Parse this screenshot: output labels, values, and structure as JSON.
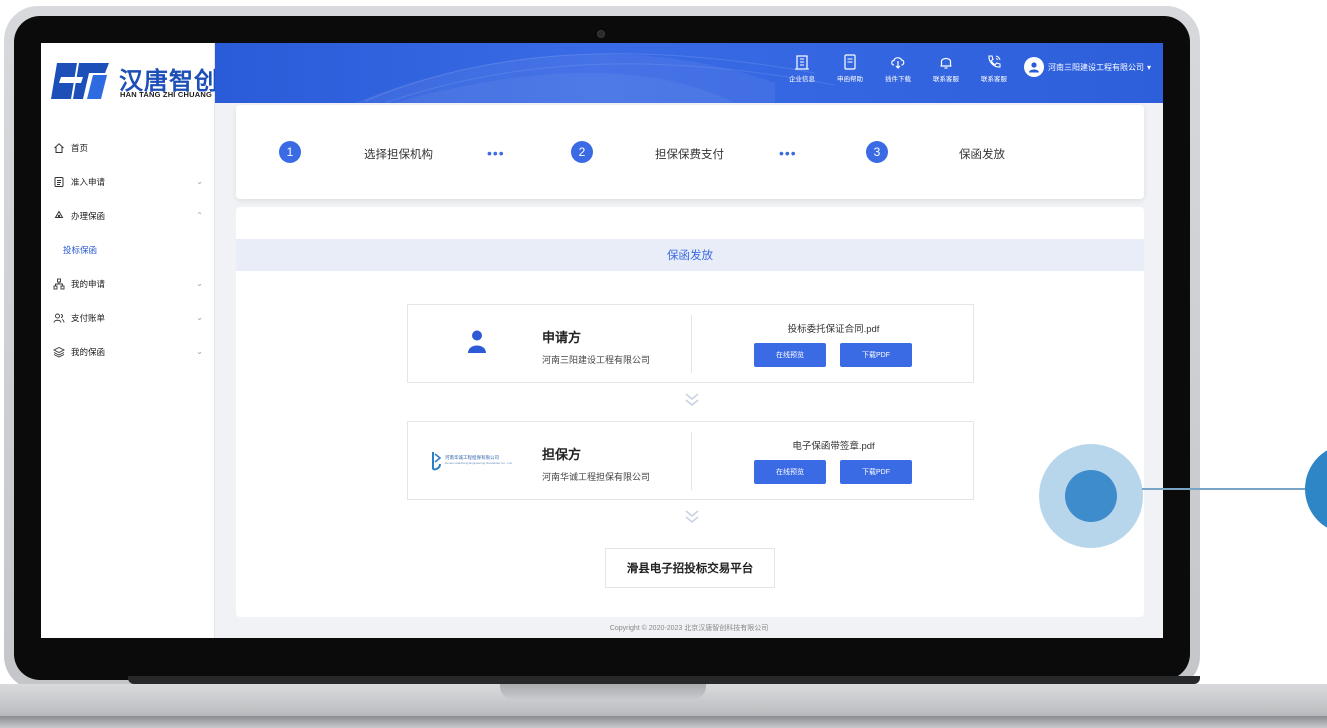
{
  "app": {
    "logo_title": "汉唐智创",
    "logo_sub": "HAN TANG ZHI CHUANG"
  },
  "sidebar": {
    "items": [
      {
        "label": "首页",
        "icon": "home-icon",
        "chevron": ""
      },
      {
        "label": "准入申请",
        "icon": "document-icon",
        "chevron": "⌄"
      },
      {
        "label": "办理保函",
        "icon": "recycle-icon",
        "chevron": "⌃"
      },
      {
        "label": "我的申请",
        "icon": "org-chart-icon",
        "chevron": "⌄"
      },
      {
        "label": "支付账单",
        "icon": "users-icon",
        "chevron": "⌄"
      },
      {
        "label": "我的保函",
        "icon": "layers-icon",
        "chevron": "⌄"
      }
    ],
    "active_sub": "投标保函"
  },
  "topbar": {
    "tools": [
      {
        "label": "企业信息",
        "icon": "building-icon"
      },
      {
        "label": "申函帮助",
        "icon": "help-doc-icon"
      },
      {
        "label": "插件下载",
        "icon": "cloud-download-icon"
      },
      {
        "label": "联系客服",
        "icon": "bell-icon"
      },
      {
        "label": "联系客服",
        "icon": "phone-icon"
      }
    ],
    "user": "河南三阳建设工程有限公司",
    "user_caret": "▾"
  },
  "steps": [
    {
      "num": "1",
      "label": "选择担保机构"
    },
    {
      "num": "2",
      "label": "担保保费支付"
    },
    {
      "num": "3",
      "label": "保函发放"
    }
  ],
  "step_dots": "•••",
  "section_title": "保函发放",
  "applicant": {
    "role": "申请方",
    "org": "河南三阳建设工程有限公司",
    "file": "投标委托保证合同.pdf",
    "preview_label": "在线预览",
    "download_label": "下载PDF"
  },
  "guarantor": {
    "role": "担保方",
    "org": "河南华诚工程担保有限公司",
    "logo_text": "河南华诚工程担保有限公司",
    "logo_en": "Henan Huacheng Engineering Guarantee Co., Ltd.",
    "file": "电子保函带签章.pdf",
    "preview_label": "在线预览",
    "download_label": "下载PDF"
  },
  "platform": "滑县电子招投标交易平台",
  "copyright": "Copyright © 2020-2023 北京汉唐智创科技有限公司",
  "colors": {
    "brand": "#2a5bd8",
    "accent": "#3a6ae4",
    "highlight_ring": "#a0c8e4",
    "highlight_dot": "#3f8ccc"
  }
}
